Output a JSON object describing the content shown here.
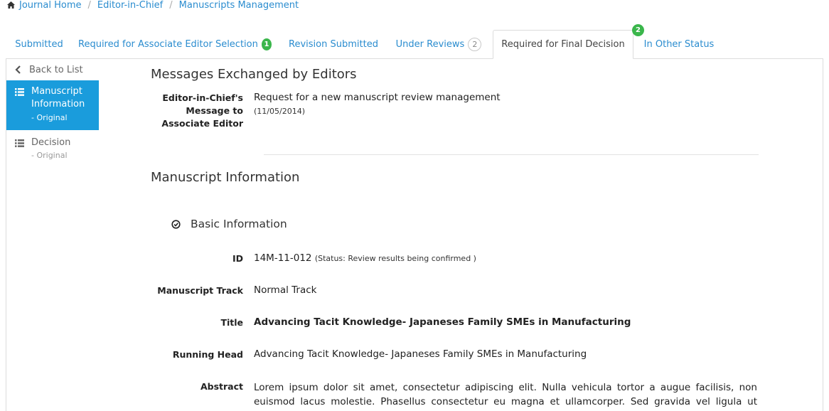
{
  "breadcrumb": {
    "items": [
      "Journal Home",
      "Editor-in-Chief",
      "Manuscripts Management"
    ]
  },
  "tabs": [
    {
      "label": "Submitted"
    },
    {
      "label": "Required for Associate Editor Selection",
      "badge": "1"
    },
    {
      "label": "Revision Submitted"
    },
    {
      "label": "Under Reviews",
      "badge": "2"
    },
    {
      "label": "Required for Final Decision",
      "badge": "2",
      "active": true
    },
    {
      "label": "In Other Status"
    }
  ],
  "sidebar": {
    "back_label": "Back to List",
    "items": [
      {
        "label": "Manuscript Information",
        "sub": "- Original",
        "active": true
      },
      {
        "label": "Decision",
        "sub": "- Original"
      }
    ]
  },
  "messages": {
    "heading": "Messages Exchanged by Editors",
    "label": "Editor-in-Chief's Message to Associate Editor",
    "text": "Request for a new manuscript review management",
    "date": "(11/05/2014)"
  },
  "manuscript": {
    "heading": "Manuscript Information",
    "basic_heading": "Basic Information",
    "fields": {
      "id_label": "ID",
      "id_value": "14M-11-012",
      "status_text": "(Status: Review results being confirmed )",
      "track_label": "Manuscript Track",
      "track_value": "Normal Track",
      "title_label": "Title",
      "title_value": "Advancing Tacit Knowledge- Japaneses Family SMEs in Manufacturing",
      "running_head_label": "Running Head",
      "running_head_value": "Advancing Tacit Knowledge- Japaneses Family SMEs in Manufacturing",
      "abstract_label": "Abstract",
      "abstract_value": "Lorem ipsum dolor sit amet, consectetur adipiscing elit. Nulla vehicula tortor a augue facilisis, non euismod lacus molestie. Phasellus consectetur eu magna et ullamcorper. Sed gravida vel ligula ut ultrices. Nulla et"
    }
  },
  "colors": {
    "link": "#2a8ccf",
    "active_sidebar": "#1a9cdc",
    "badge_green": "#3ab64b"
  },
  "icons": [
    "home-icon",
    "chevron-left-icon",
    "list-icon",
    "circle-check-icon"
  ]
}
